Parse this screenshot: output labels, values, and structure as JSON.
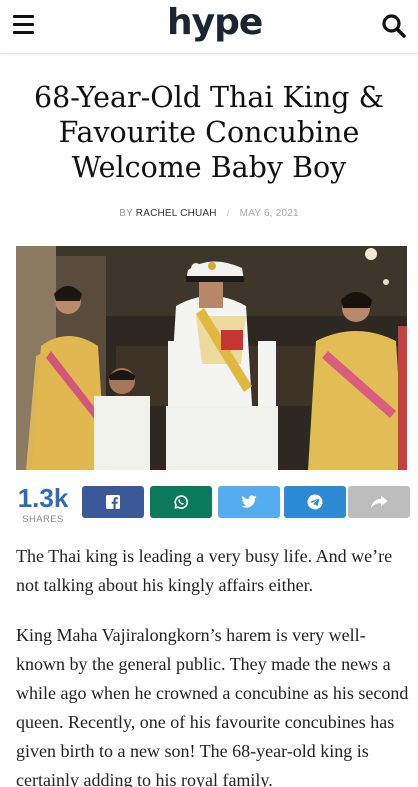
{
  "header": {
    "logo_text": "hype",
    "menu_icon": "hamburger-menu-icon",
    "search_icon": "search-icon",
    "logo_color": "#1c2430"
  },
  "article": {
    "title": "68-Year-Old Thai King & Favourite Concubine Welcome Baby Boy",
    "byline_prefix": "BY",
    "author": "RACHEL CHUAH",
    "separator": "/",
    "date": "MAY 6, 2021",
    "paragraphs": [
      "The Thai king is leading a very busy life. And we’re not talking about his kingly affairs either.",
      "King Maha Vajiralongkorn’s harem is very well-known by the general public. They made the news a while ago when he crowned a concubine as his second queen. Recently, one of his favourite concubines has given birth to a new son! The 68-year-old king is certainly adding to his royal family."
    ]
  },
  "share": {
    "count": "1.3k",
    "label": "SHARES",
    "count_color": "#2f6bb4",
    "buttons": [
      {
        "network": "facebook",
        "icon": "facebook-icon",
        "color": "#3b5998"
      },
      {
        "network": "whatsapp",
        "icon": "whatsapp-icon",
        "color": "#0b7a5b"
      },
      {
        "network": "twitter",
        "icon": "twitter-icon",
        "color": "#55acee"
      },
      {
        "network": "telegram",
        "icon": "telegram-icon",
        "color": "#2d8ad4"
      },
      {
        "network": "more",
        "icon": "share-arrow-icon",
        "color": "#bdbdbd"
      }
    ]
  }
}
